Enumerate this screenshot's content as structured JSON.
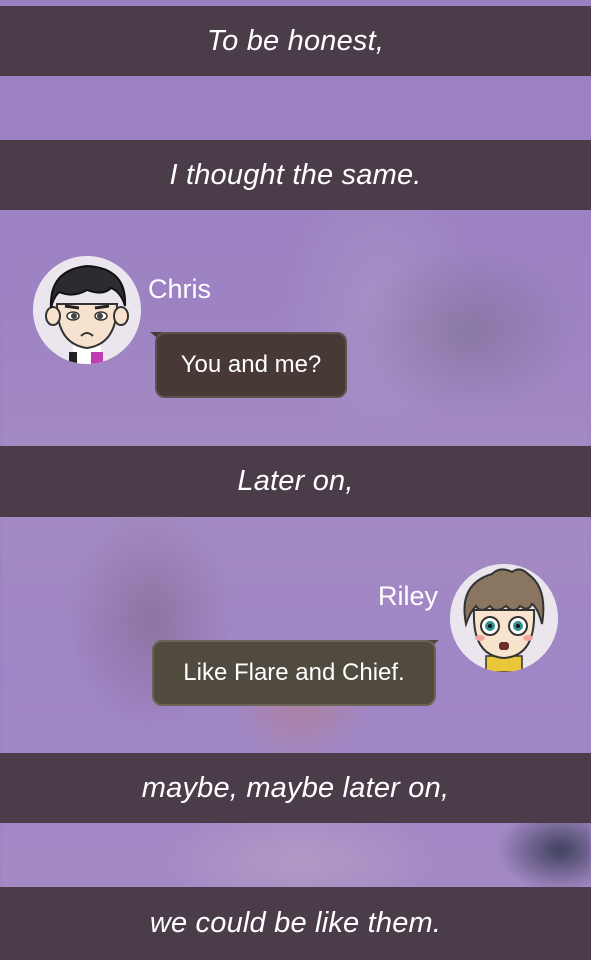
{
  "narration": [
    "To be honest,",
    "I thought the same.",
    "Later on,",
    "maybe, maybe later on,",
    "we could be like them."
  ],
  "messages": [
    {
      "speaker": "Chris",
      "text": "You and me?",
      "avatar_icon": "chris-avatar-icon"
    },
    {
      "speaker": "Riley",
      "text": "Like Flare and Chief.",
      "avatar_icon": "riley-avatar-icon"
    }
  ],
  "colors": {
    "background": "#9b80c4",
    "banner": "#483a46",
    "bubble_chris": "#473a36",
    "bubble_riley": "#514a3e",
    "text": "#ffffff"
  }
}
